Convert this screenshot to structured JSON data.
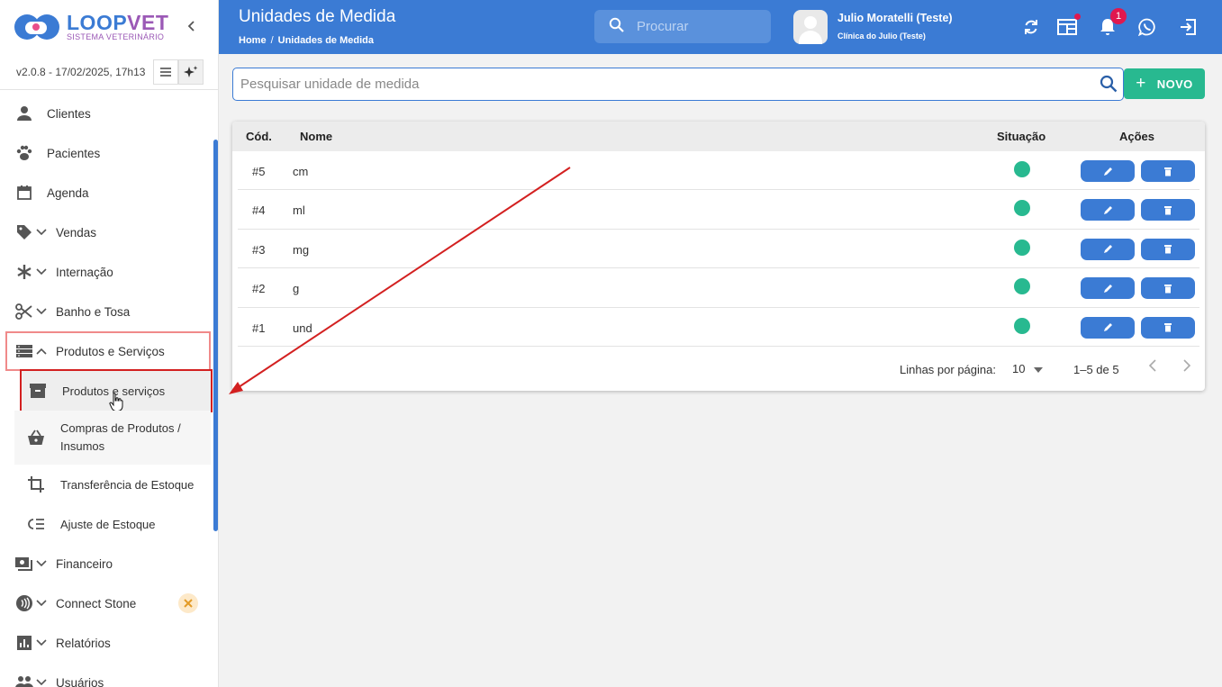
{
  "app": {
    "brand_loop": "LOOP",
    "brand_vet": "VET",
    "brand_sub": "SISTEMA VETERINÁRIO",
    "version": "v2.0.8 - 17/02/2025, 17h13"
  },
  "sidebar": {
    "items": [
      {
        "label": "Clientes",
        "icon": "person-icon"
      },
      {
        "label": "Pacientes",
        "icon": "paw-icon"
      },
      {
        "label": "Agenda",
        "icon": "calendar-icon"
      },
      {
        "label": "Vendas",
        "icon": "tag-icon"
      },
      {
        "label": "Internação",
        "icon": "asterisk-icon"
      },
      {
        "label": "Banho e Tosa",
        "icon": "scissors-icon"
      },
      {
        "label": "Produtos e Serviços",
        "icon": "storage-icon"
      },
      {
        "label": "Financeiro",
        "icon": "money-icon"
      },
      {
        "label": "Connect Stone",
        "icon": "contactless-icon"
      },
      {
        "label": "Relatórios",
        "icon": "chart-icon"
      },
      {
        "label": "Usuários",
        "icon": "group-icon"
      }
    ],
    "sub_items": [
      {
        "label": "Produtos e serviços",
        "icon": "archive-icon"
      },
      {
        "label": "Compras de Produtos / Insumos",
        "icon": "basket-icon"
      },
      {
        "label": "Transferência de Estoque",
        "icon": "crop-icon"
      },
      {
        "label": "Ajuste de Estoque",
        "icon": "list-adjust-icon"
      }
    ]
  },
  "header": {
    "title": "Unidades de Medida",
    "breadcrumb_home": "Home",
    "breadcrumb_sep": "/",
    "breadcrumb_current": "Unidades de Medida",
    "search_placeholder": "Procurar",
    "user_name": "Julio Moratelli (Teste)",
    "user_clinic": "Clínica do Julio (Teste)",
    "notif_count": "1"
  },
  "main": {
    "filter_placeholder": "Pesquisar unidade de medida",
    "novo_label": "NOVO",
    "columns": {
      "cod": "Cód.",
      "nome": "Nome",
      "situacao": "Situação",
      "acoes": "Ações"
    },
    "rows": [
      {
        "cod": "#5",
        "nome": "cm",
        "status": "active"
      },
      {
        "cod": "#4",
        "nome": "ml",
        "status": "active"
      },
      {
        "cod": "#3",
        "nome": "mg",
        "status": "active"
      },
      {
        "cod": "#2",
        "nome": "g",
        "status": "active"
      },
      {
        "cod": "#1",
        "nome": "und",
        "status": "active"
      }
    ],
    "rows_per_page_label": "Linhas por página:",
    "rows_per_page": "10",
    "range": "1–5 de 5"
  },
  "colors": {
    "primary": "#3b7bd4",
    "success": "#28b990",
    "badge": "#e0184f",
    "annotation": "#d32020"
  }
}
